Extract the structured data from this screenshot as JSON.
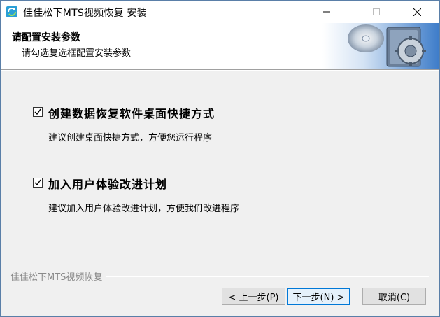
{
  "window": {
    "title": "佳佳松下MTS视频恢复 安装",
    "controls": {
      "minimize": "—",
      "maximize": "☐",
      "close": "✕"
    }
  },
  "header": {
    "title": "请配置安装参数",
    "subtitle": "请勾选复选框配置安装参数"
  },
  "options": [
    {
      "label": "创建数据恢复软件桌面快捷方式",
      "description": "建议创建桌面快捷方式，方便您运行程序",
      "checked": true
    },
    {
      "label": "加入用户体验改进计划",
      "description": "建议加入用户体验改进计划，方便我们改进程序",
      "checked": true
    }
  ],
  "footer": {
    "brand": "佳佳松下MTS视频恢复"
  },
  "buttons": {
    "back": "< 上一步(P)",
    "next": "下一步(N) >",
    "cancel": "取消(C)"
  },
  "colors": {
    "accent": "#0078d7",
    "header_bg": "#ffffff",
    "body_bg": "#f0f0f0"
  }
}
